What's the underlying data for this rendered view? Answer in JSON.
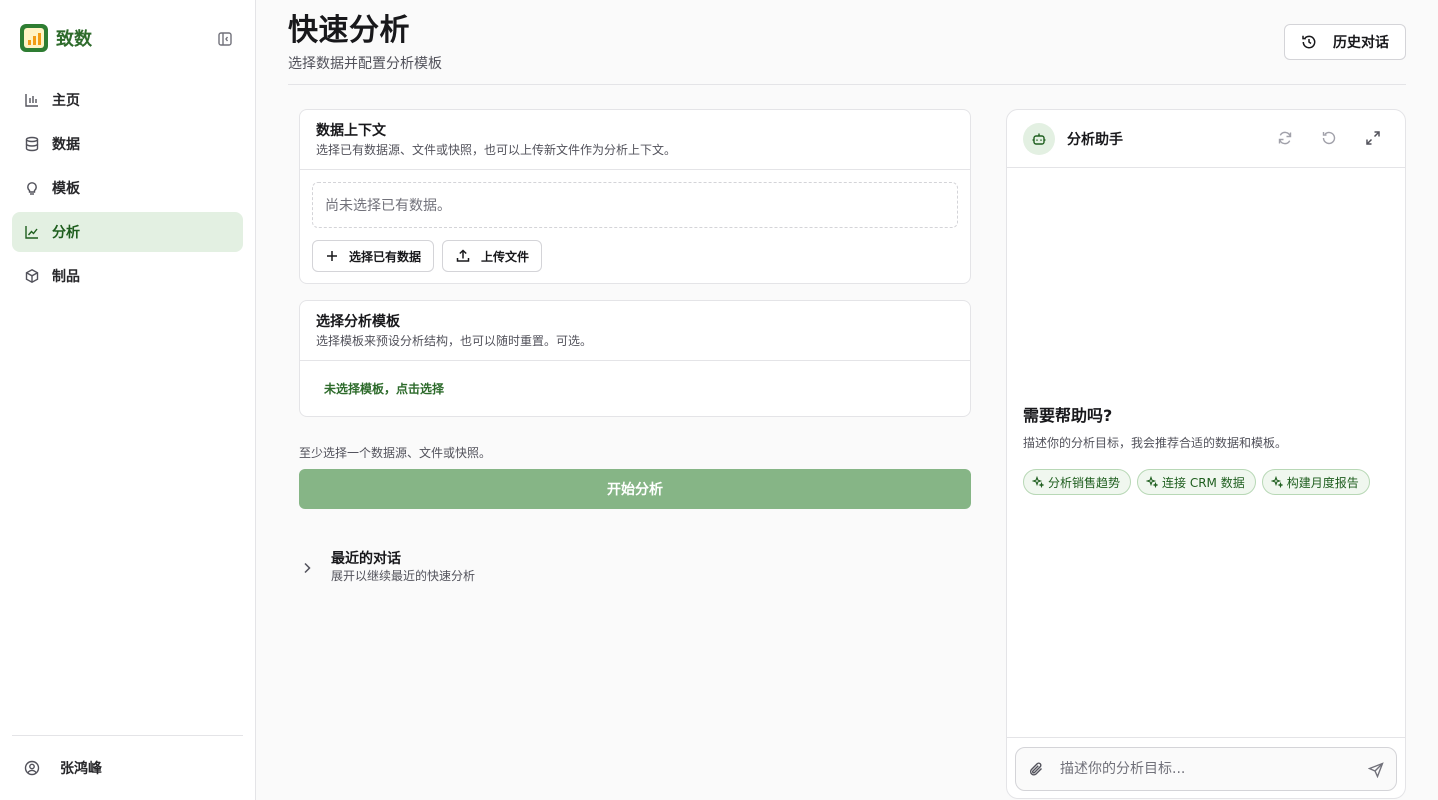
{
  "app": {
    "name": "致数"
  },
  "nav": [
    {
      "label": "主页",
      "icon": "bar-chart-icon",
      "active": false
    },
    {
      "label": "数据",
      "icon": "database-icon",
      "active": false
    },
    {
      "label": "模板",
      "icon": "lightbulb-icon",
      "active": false
    },
    {
      "label": "分析",
      "icon": "line-chart-icon",
      "active": true
    },
    {
      "label": "制品",
      "icon": "box-icon",
      "active": false
    }
  ],
  "user": {
    "name": "张鸿峰"
  },
  "header": {
    "title": "快速分析",
    "subtitle": "选择数据并配置分析模板",
    "history_label": "历史对话"
  },
  "data_context": {
    "title": "数据上下文",
    "desc": "选择已有数据源、文件或快照，也可以上传新文件作为分析上下文。",
    "empty_text": "尚未选择已有数据。",
    "select_label": "选择已有数据",
    "upload_label": "上传文件"
  },
  "template": {
    "title": "选择分析模板",
    "desc": "选择模板来预设分析结构，也可以随时重置。可选。",
    "link_label": "未选择模板，点击选择"
  },
  "hint": "至少选择一个数据源、文件或快照。",
  "start_label": "开始分析",
  "recent": {
    "title": "最近的对话",
    "desc": "展开以继续最近的快速分析"
  },
  "assistant": {
    "title": "分析助手",
    "help_title": "需要帮助吗?",
    "help_desc": "描述你的分析目标，我会推荐合适的数据和模板。",
    "chips": [
      "分析销售趋势",
      "连接 CRM 数据",
      "构建月度报告"
    ],
    "input_placeholder": "描述你的分析目标..."
  },
  "colors": {
    "brand": "#2e7d32",
    "active_bg": "#e3f0e2",
    "start_button": "#86b586"
  }
}
